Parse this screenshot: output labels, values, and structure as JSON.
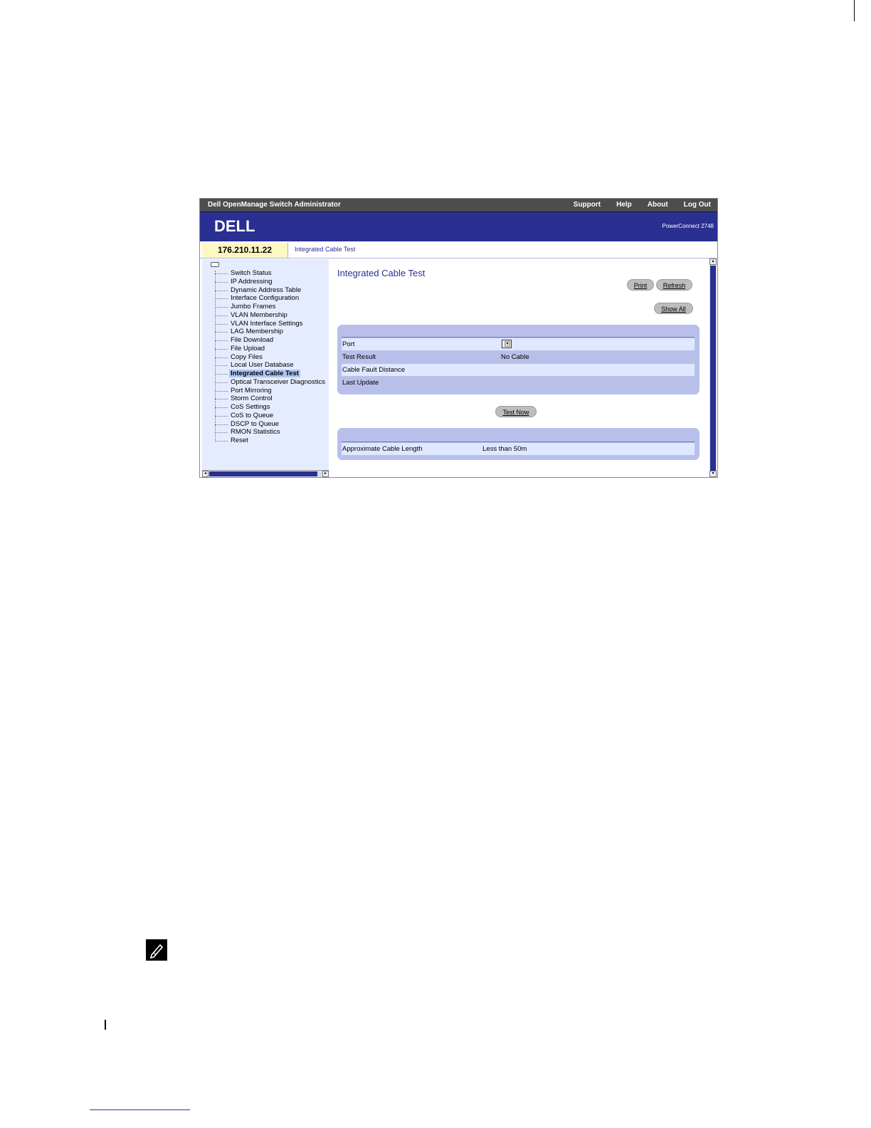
{
  "window": {
    "app_title": "Dell OpenManage Switch Administrator",
    "top_links": [
      "Support",
      "Help",
      "About",
      "Log Out"
    ],
    "logo": "DELL",
    "product": "PowerConnect 2748",
    "ip": "176.210.11.22",
    "breadcrumb": "Integrated Cable Test"
  },
  "nav": {
    "items": [
      "Switch Status",
      "IP Addressing",
      "Dynamic Address Table",
      "Interface Configuration",
      "Jumbo Frames",
      "VLAN Membership",
      "VLAN Interface Settings",
      "LAG Membership",
      "File Download",
      "File Upload",
      "Copy Files",
      "Local User Database",
      "Integrated Cable Test",
      "Optical Transceiver Diagnostics",
      "Port Mirroring",
      "Storm Control",
      "CoS Settings",
      "CoS to Queue",
      "DSCP to Queue",
      "RMON Statistics",
      "Reset"
    ],
    "active_item": "Integrated Cable Test"
  },
  "main": {
    "title": "Integrated Cable Test",
    "print_label": "Print",
    "refresh_label": "Refresh",
    "show_all_label": "Show All",
    "test_now_label": "Test Now",
    "form": {
      "port_label": "Port",
      "test_result_label": "Test Result",
      "test_result_value": "No Cable",
      "cable_fault_label": "Cable Fault Distance",
      "last_update_label": "Last Update"
    },
    "length": {
      "label": "Approximate Cable Length",
      "value": "Less than 50m"
    }
  },
  "colors": {
    "banner": "#2a2f92",
    "panel": "#b8c0ea",
    "highlight": "#fff7c2"
  }
}
